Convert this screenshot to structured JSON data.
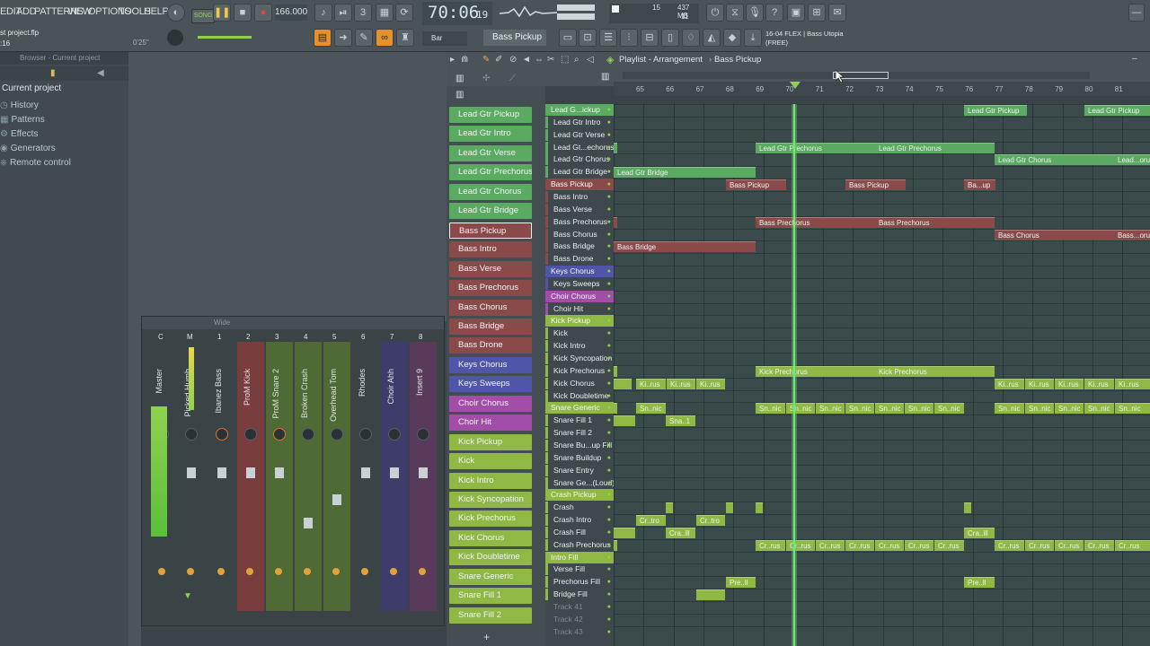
{
  "menu": [
    "EDIT",
    "ADD",
    "PATTERNS",
    "VIEW",
    "OPTIONS",
    "TOOLS",
    "HELP"
  ],
  "project_file": "st project.flp",
  "project_sub": ":16",
  "project_time": "0'25\"",
  "song_label": "SONG",
  "tempo": "166.000",
  "time_display": "70:06",
  "time_ticks": "19",
  "cpu_value": "15",
  "mem_value": "437 MB",
  "poly_value": "11",
  "snap_label": "Bar",
  "pattern_name": "Bass Pickup",
  "news_line1": "16-04  FLEX | Bass Utopia",
  "news_line2": "(FREE)",
  "browser": {
    "title": "Browser - Current project",
    "heading": "Current project",
    "items": [
      "History",
      "Patterns",
      "Effects",
      "Generators",
      "Remote control"
    ]
  },
  "mixer": {
    "title": "Wide",
    "strips": [
      "Master",
      "Picked Humb",
      "Ibanez Bass",
      "ProM Kick",
      "ProM Snare 2",
      "Broken Crash",
      "Overhead Tom",
      "Rhodes",
      "Choir Ahh",
      "Insert 9"
    ],
    "numbers": [
      "C",
      "M",
      "1",
      "2",
      "3",
      "4",
      "5",
      "6",
      "7",
      "8"
    ]
  },
  "channels": [
    {
      "name": "Lead Gtr Pickup",
      "color": "#5aaa62"
    },
    {
      "name": "Lead Gtr Intro",
      "color": "#5aaa62"
    },
    {
      "name": "Lead Gtr Verse",
      "color": "#5aaa62"
    },
    {
      "name": "Lead Gtr Prechorus",
      "color": "#5aaa62"
    },
    {
      "name": "Lead Gtr Chorus",
      "color": "#5aaa62"
    },
    {
      "name": "Lead Gtr Bridge",
      "color": "#5aaa62"
    },
    {
      "name": "Bass Pickup",
      "color": "#8a4a4a"
    },
    {
      "name": "Bass Intro",
      "color": "#8a4a4a"
    },
    {
      "name": "Bass Verse",
      "color": "#8a4a4a"
    },
    {
      "name": "Bass Prechorus",
      "color": "#8a4a4a"
    },
    {
      "name": "Bass Chorus",
      "color": "#8a4a4a"
    },
    {
      "name": "Bass Bridge",
      "color": "#8a4a4a"
    },
    {
      "name": "Bass Drone",
      "color": "#8a4a4a"
    },
    {
      "name": "Keys Chorus",
      "color": "#4f55a8"
    },
    {
      "name": "Keys Sweeps",
      "color": "#4f55a8"
    },
    {
      "name": "Choir Chorus",
      "color": "#a24ea8"
    },
    {
      "name": "Choir Hit",
      "color": "#a24ea8"
    },
    {
      "name": "Kick Pickup",
      "color": "#8fb845"
    },
    {
      "name": "Kick",
      "color": "#8fb845"
    },
    {
      "name": "Kick Intro",
      "color": "#8fb845"
    },
    {
      "name": "Kick Syncopation",
      "color": "#8fb845"
    },
    {
      "name": "Kick Prechorus",
      "color": "#8fb845"
    },
    {
      "name": "Kick Chorus",
      "color": "#8fb845"
    },
    {
      "name": "Kick Doubletime",
      "color": "#8fb845"
    },
    {
      "name": "Snare Generic",
      "color": "#8fb845"
    },
    {
      "name": "Snare Fill 1",
      "color": "#8fb845"
    },
    {
      "name": "Snare Fill 2",
      "color": "#8fb845"
    }
  ],
  "playlist": {
    "title": "Playlist - Arrangement",
    "pattern": "Bass Pickup",
    "ruler": [
      "65",
      "66",
      "67",
      "68",
      "69",
      "70",
      "71",
      "72",
      "73",
      "74",
      "75",
      "76",
      "77",
      "78",
      "79",
      "80",
      "81"
    ],
    "tracks": [
      {
        "name": "Lead G...ickup",
        "color": "#5aaa62",
        "group": true
      },
      {
        "name": "Lead Gtr Intro",
        "color": "#5aaa62"
      },
      {
        "name": "Lead Gtr Verse",
        "color": "#5aaa62"
      },
      {
        "name": "Lead Gt...echorus",
        "color": "#5aaa62"
      },
      {
        "name": "Lead Gtr Chorus",
        "color": "#5aaa62"
      },
      {
        "name": "Lead Gtr Bridge",
        "color": "#5aaa62"
      },
      {
        "name": "Bass Pickup",
        "color": "#8a4a4a",
        "group": true
      },
      {
        "name": "Bass Intro",
        "color": "#8a4a4a"
      },
      {
        "name": "Bass Verse",
        "color": "#8a4a4a"
      },
      {
        "name": "Bass Prechorus",
        "color": "#8a4a4a"
      },
      {
        "name": "Bass Chorus",
        "color": "#8a4a4a"
      },
      {
        "name": "Bass Bridge",
        "color": "#8a4a4a"
      },
      {
        "name": "Bass Drone",
        "color": "#8a4a4a"
      },
      {
        "name": "Keys Chorus",
        "color": "#4f55a8",
        "group": true
      },
      {
        "name": "Keys Sweeps",
        "color": "#4f55a8"
      },
      {
        "name": "Choir Chorus",
        "color": "#a24ea8",
        "group": true
      },
      {
        "name": "Choir Hit",
        "color": "#a24ea8"
      },
      {
        "name": "Kick Pickup",
        "color": "#8fb845",
        "group": true
      },
      {
        "name": "Kick",
        "color": "#8fb845"
      },
      {
        "name": "Kick Intro",
        "color": "#8fb845"
      },
      {
        "name": "Kick Syncopation",
        "color": "#8fb845"
      },
      {
        "name": "Kick Prechorus",
        "color": "#8fb845"
      },
      {
        "name": "Kick Chorus",
        "color": "#8fb845"
      },
      {
        "name": "Kick Doubletime",
        "color": "#8fb845"
      },
      {
        "name": "Snare Generic",
        "color": "#8fb845",
        "group": true
      },
      {
        "name": "Snare Fill 1",
        "color": "#8fb845"
      },
      {
        "name": "Snare Fill 2",
        "color": "#8fb845"
      },
      {
        "name": "Snare Bu...up Fill",
        "color": "#8fb845"
      },
      {
        "name": "Snare Buildup",
        "color": "#8fb845"
      },
      {
        "name": "Snare Entry",
        "color": "#8fb845"
      },
      {
        "name": "Snare Ge...(Loud)",
        "color": "#8fb845"
      },
      {
        "name": "Crash Pickup",
        "color": "#8fb845",
        "group": true
      },
      {
        "name": "Crash",
        "color": "#8fb845"
      },
      {
        "name": "Crash Intro",
        "color": "#8fb845"
      },
      {
        "name": "Crash Fill",
        "color": "#8fb845"
      },
      {
        "name": "Crash Prechorus",
        "color": "#8fb845"
      },
      {
        "name": "Intro Fill",
        "color": "#8fb845",
        "group": true
      },
      {
        "name": "Verse Fill",
        "color": "#8fb845"
      },
      {
        "name": "Prechorus Fill",
        "color": "#8fb845"
      },
      {
        "name": "Bridge Fill",
        "color": "#8fb845"
      },
      {
        "name": "Track 41",
        "color": "#3f494d"
      },
      {
        "name": "Track 42",
        "color": "#3f494d"
      },
      {
        "name": "Track 43",
        "color": "#3f494d"
      }
    ],
    "clips": [
      {
        "row": 0,
        "from": 390,
        "to": 460,
        "text": "Lead Gtr Pickup",
        "color": "#5aaa62"
      },
      {
        "row": 0,
        "from": 524,
        "to": 597,
        "text": "Lead Gtr Pickup",
        "color": "#5aaa62"
      },
      {
        "row": 3,
        "from": 0,
        "to": 3,
        "text": "",
        "color": "#5aaa62"
      },
      {
        "row": 3,
        "from": 158,
        "to": 291,
        "text": "Lead Gtr Prechorus",
        "color": "#5aaa62"
      },
      {
        "row": 3,
        "from": 291,
        "to": 424,
        "text": "Lead Gtr Prechorus",
        "color": "#5aaa62"
      },
      {
        "row": 4,
        "from": 424,
        "to": 557,
        "text": "Lead Gtr Chorus",
        "color": "#5aaa62"
      },
      {
        "row": 4,
        "from": 557,
        "to": 597,
        "text": "Lead...orus",
        "color": "#5aaa62"
      },
      {
        "row": 5,
        "from": 0,
        "to": 158,
        "text": "Lead Gtr Bridge",
        "color": "#5aaa62"
      },
      {
        "row": 6,
        "from": 125,
        "to": 192,
        "text": "Bass Pickup",
        "color": "#8a4a4a"
      },
      {
        "row": 6,
        "from": 258,
        "to": 325,
        "text": "Bass Pickup",
        "color": "#8a4a4a"
      },
      {
        "row": 6,
        "from": 390,
        "to": 425,
        "text": "Ba...up",
        "color": "#8a4a4a"
      },
      {
        "row": 9,
        "from": 0,
        "to": 3,
        "text": "",
        "color": "#8a4a4a"
      },
      {
        "row": 9,
        "from": 158,
        "to": 291,
        "text": "Bass Prechorus",
        "color": "#8a4a4a"
      },
      {
        "row": 9,
        "from": 291,
        "to": 424,
        "text": "Bass Prechorus",
        "color": "#8a4a4a"
      },
      {
        "row": 10,
        "from": 424,
        "to": 557,
        "text": "Bass Chorus",
        "color": "#8a4a4a"
      },
      {
        "row": 10,
        "from": 557,
        "to": 597,
        "text": "Bass...orus",
        "color": "#8a4a4a"
      },
      {
        "row": 11,
        "from": 0,
        "to": 158,
        "text": "Bass Bridge",
        "color": "#8a4a4a"
      },
      {
        "row": 21,
        "from": 0,
        "to": 3,
        "text": "",
        "color": "#8fb845"
      },
      {
        "row": 21,
        "from": 158,
        "to": 291,
        "text": "Kick Prechorus",
        "color": "#8fb845"
      },
      {
        "row": 21,
        "from": 291,
        "to": 424,
        "text": "Kick Prechorus",
        "color": "#8fb845"
      },
      {
        "row": 22,
        "from": 0,
        "to": 20,
        "text": "",
        "color": "#8fb845"
      },
      {
        "row": 22,
        "from": 25,
        "to": 58,
        "text": "Ki..rus",
        "color": "#8fb845"
      },
      {
        "row": 22,
        "from": 59,
        "to": 91,
        "text": "Ki..rus",
        "color": "#8fb845"
      },
      {
        "row": 22,
        "from": 92,
        "to": 124,
        "text": "Ki..rus",
        "color": "#8fb845"
      },
      {
        "row": 22,
        "from": 424,
        "to": 457,
        "text": "Ki..rus",
        "color": "#8fb845"
      },
      {
        "row": 22,
        "from": 458,
        "to": 490,
        "text": "Ki..rus",
        "color": "#8fb845"
      },
      {
        "row": 22,
        "from": 491,
        "to": 523,
        "text": "Ki..rus",
        "color": "#8fb845"
      },
      {
        "row": 22,
        "from": 524,
        "to": 557,
        "text": "Ki..rus",
        "color": "#8fb845"
      },
      {
        "row": 22,
        "from": 558,
        "to": 597,
        "text": "Ki..rus",
        "color": "#8fb845"
      },
      {
        "row": 24,
        "from": 0,
        "to": 3,
        "text": "",
        "color": "#8fb845"
      },
      {
        "row": 24,
        "from": 25,
        "to": 58,
        "text": "Sn..nic",
        "color": "#8fb845"
      },
      {
        "row": 24,
        "from": 158,
        "to": 191,
        "text": "Sn..nic",
        "color": "#8fb845"
      },
      {
        "row": 24,
        "from": 192,
        "to": 224,
        "text": "Sn..nic",
        "color": "#8fb845"
      },
      {
        "row": 24,
        "from": 225,
        "to": 257,
        "text": "Sn..nic",
        "color": "#8fb845"
      },
      {
        "row": 24,
        "from": 258,
        "to": 290,
        "text": "Sn..nic",
        "color": "#8fb845"
      },
      {
        "row": 24,
        "from": 291,
        "to": 323,
        "text": "Sn..nic",
        "color": "#8fb845"
      },
      {
        "row": 24,
        "from": 324,
        "to": 356,
        "text": "Sn..nic",
        "color": "#8fb845"
      },
      {
        "row": 24,
        "from": 357,
        "to": 390,
        "text": "Sn..nic",
        "color": "#8fb845"
      },
      {
        "row": 24,
        "from": 424,
        "to": 457,
        "text": "Sn..nic",
        "color": "#8fb845"
      },
      {
        "row": 24,
        "from": 458,
        "to": 490,
        "text": "Sn..nic",
        "color": "#8fb845"
      },
      {
        "row": 24,
        "from": 491,
        "to": 523,
        "text": "Sn..nic",
        "color": "#8fb845"
      },
      {
        "row": 24,
        "from": 524,
        "to": 557,
        "text": "Sn..nic",
        "color": "#8fb845"
      },
      {
        "row": 24,
        "from": 558,
        "to": 597,
        "text": "Sn..nic",
        "color": "#8fb845"
      },
      {
        "row": 25,
        "from": 0,
        "to": 24,
        "text": "",
        "color": "#8fb845"
      },
      {
        "row": 25,
        "from": 58,
        "to": 91,
        "text": "Sna..1",
        "color": "#8fb845"
      },
      {
        "row": 32,
        "from": 58,
        "to": 66,
        "text": "",
        "color": "#8fb845"
      },
      {
        "row": 32,
        "from": 125,
        "to": 133,
        "text": "",
        "color": "#8fb845"
      },
      {
        "row": 32,
        "from": 158,
        "to": 166,
        "text": "",
        "color": "#8fb845"
      },
      {
        "row": 32,
        "from": 390,
        "to": 398,
        "text": "",
        "color": "#8fb845"
      },
      {
        "row": 33,
        "from": 25,
        "to": 58,
        "text": "Cr..tro",
        "color": "#8fb845"
      },
      {
        "row": 33,
        "from": 92,
        "to": 124,
        "text": "Cr..tro",
        "color": "#8fb845"
      },
      {
        "row": 34,
        "from": 0,
        "to": 24,
        "text": "",
        "color": "#8fb845"
      },
      {
        "row": 34,
        "from": 58,
        "to": 91,
        "text": "Cra..ill",
        "color": "#8fb845"
      },
      {
        "row": 34,
        "from": 390,
        "to": 424,
        "text": "Cra..ill",
        "color": "#8fb845"
      },
      {
        "row": 35,
        "from": 0,
        "to": 3,
        "text": "",
        "color": "#8fb845"
      },
      {
        "row": 35,
        "from": 158,
        "to": 191,
        "text": "Cr..rus",
        "color": "#8fb845"
      },
      {
        "row": 35,
        "from": 192,
        "to": 224,
        "text": "Cr..rus",
        "color": "#8fb845"
      },
      {
        "row": 35,
        "from": 225,
        "to": 257,
        "text": "Cr..rus",
        "color": "#8fb845"
      },
      {
        "row": 35,
        "from": 258,
        "to": 290,
        "text": "Cr..rus",
        "color": "#8fb845"
      },
      {
        "row": 35,
        "from": 291,
        "to": 323,
        "text": "Cr..rus",
        "color": "#8fb845"
      },
      {
        "row": 35,
        "from": 324,
        "to": 356,
        "text": "Cr..rus",
        "color": "#8fb845"
      },
      {
        "row": 35,
        "from": 357,
        "to": 390,
        "text": "Cr..rus",
        "color": "#8fb845"
      },
      {
        "row": 35,
        "from": 424,
        "to": 457,
        "text": "Cr..rus",
        "color": "#8fb845"
      },
      {
        "row": 35,
        "from": 458,
        "to": 490,
        "text": "Cr..rus",
        "color": "#8fb845"
      },
      {
        "row": 35,
        "from": 491,
        "to": 523,
        "text": "Cr..rus",
        "color": "#8fb845"
      },
      {
        "row": 35,
        "from": 524,
        "to": 557,
        "text": "Cr..rus",
        "color": "#8fb845"
      },
      {
        "row": 35,
        "from": 558,
        "to": 597,
        "text": "Cr..rus",
        "color": "#8fb845"
      },
      {
        "row": 38,
        "from": 125,
        "to": 158,
        "text": "Pre..ll",
        "color": "#8fb845"
      },
      {
        "row": 38,
        "from": 390,
        "to": 424,
        "text": "Pre..ll",
        "color": "#8fb845"
      },
      {
        "row": 39,
        "from": 92,
        "to": 108,
        "text": "",
        "color": "#8fb845"
      },
      {
        "row": 39,
        "from": 108,
        "to": 124,
        "text": "",
        "color": "#8fb845"
      }
    ]
  },
  "colors": {
    "accent": "#8fd14f",
    "playhead": "#5bd15b",
    "lcd": "#d6e4ea"
  }
}
